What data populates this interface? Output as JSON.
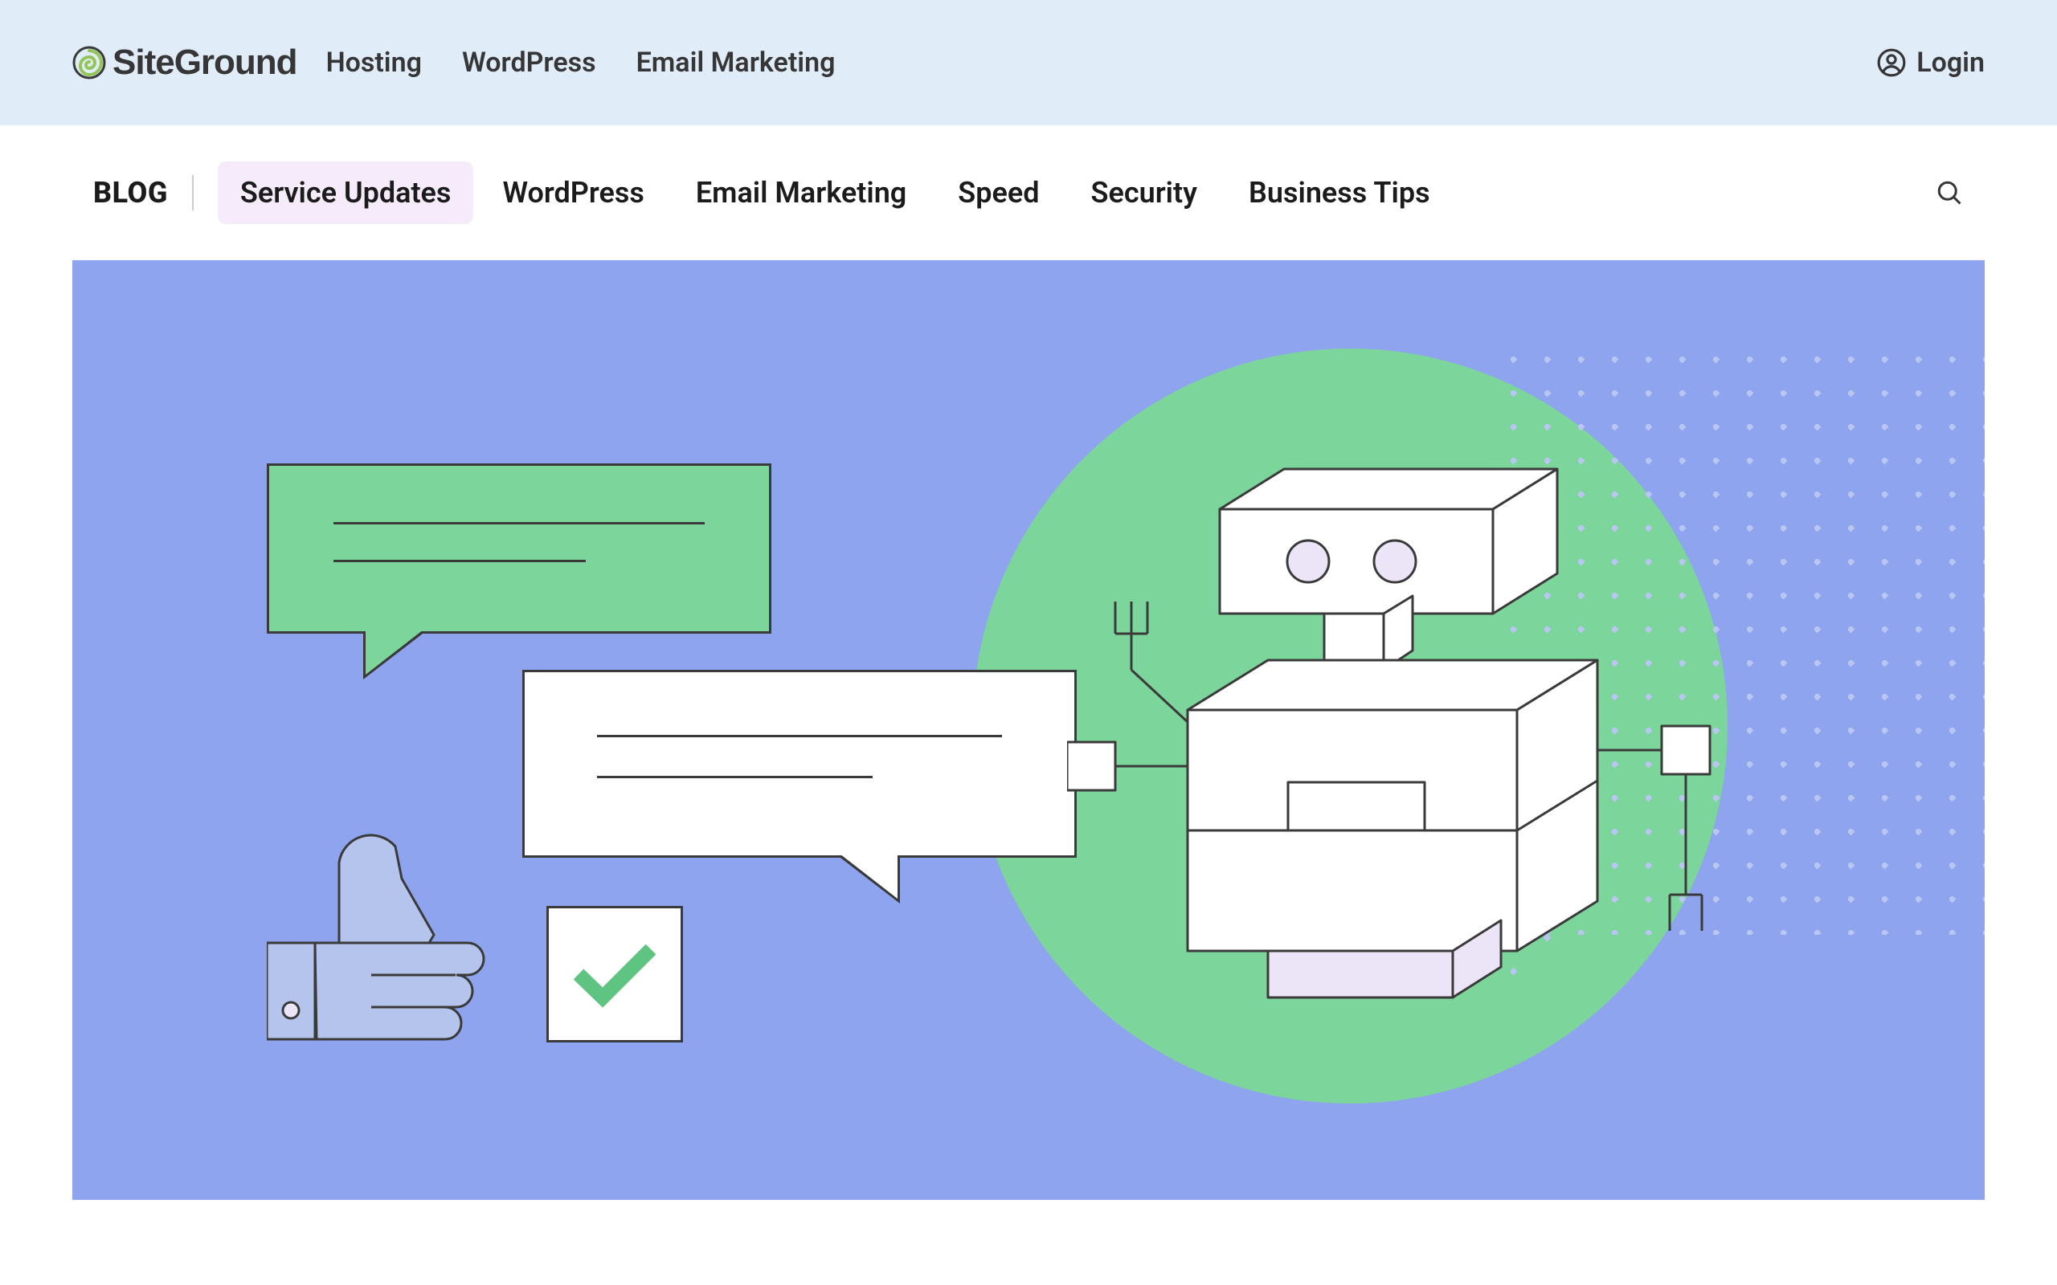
{
  "brand": {
    "name": "SiteGround"
  },
  "nav": {
    "items": [
      "Hosting",
      "WordPress",
      "Email Marketing"
    ]
  },
  "login": {
    "label": "Login"
  },
  "blognav": {
    "blog_label": "BLOG",
    "tabs": [
      {
        "label": "Service Updates",
        "active": true
      },
      {
        "label": "WordPress",
        "active": false
      },
      {
        "label": "Email Marketing",
        "active": false
      },
      {
        "label": "Speed",
        "active": false
      },
      {
        "label": "Security",
        "active": false
      },
      {
        "label": "Business Tips",
        "active": false
      }
    ]
  },
  "colors": {
    "topbar_bg": "#e1ecf9",
    "hero_bg": "#8ea4ef",
    "green": "#7cd59a",
    "lavender_fill": "#ece4f7"
  }
}
